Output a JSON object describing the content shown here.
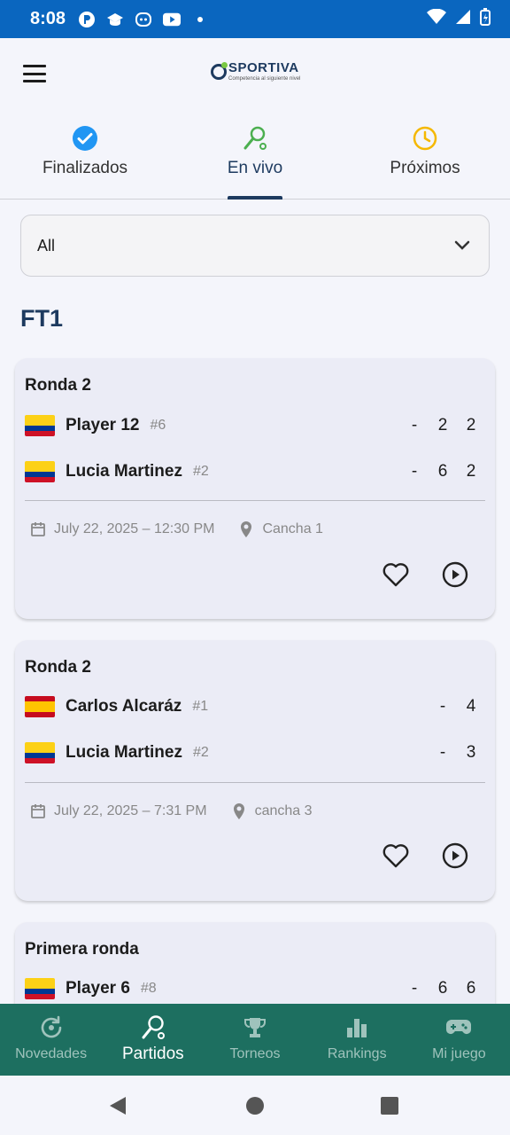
{
  "status_bar": {
    "time": "8:08"
  },
  "header": {
    "logo_name": "SPORTIVA",
    "logo_tagline": "Competencia al siguiente nivel"
  },
  "tabs": [
    {
      "label": "Finalizados",
      "icon": "check-circle-icon",
      "color": "#2196f3",
      "active": false
    },
    {
      "label": "En vivo",
      "icon": "tennis-racket-icon",
      "color": "#4caf50",
      "active": true
    },
    {
      "label": "Próximos",
      "icon": "clock-icon",
      "color": "#f5b800",
      "active": false
    }
  ],
  "filter": {
    "value": "All"
  },
  "section": {
    "title": "FT1"
  },
  "matches": [
    {
      "round": "Ronda 2",
      "players": [
        {
          "flag": "CO",
          "name": "Player 12",
          "seed": "#6",
          "scores": [
            "-",
            "2",
            "2"
          ]
        },
        {
          "flag": "CO",
          "name": "Lucia Martinez",
          "seed": "#2",
          "scores": [
            "-",
            "6",
            "2"
          ]
        }
      ],
      "datetime": "July 22, 2025 – 12:30 PM",
      "court": "Cancha 1"
    },
    {
      "round": "Ronda 2",
      "players": [
        {
          "flag": "ES",
          "name": "Carlos Alcaráz",
          "seed": "#1",
          "scores": [
            "-",
            "4"
          ]
        },
        {
          "flag": "CO",
          "name": "Lucia Martinez",
          "seed": "#2",
          "scores": [
            "-",
            "3"
          ]
        }
      ],
      "datetime": "July 22, 2025 – 7:31 PM",
      "court": "cancha 3"
    },
    {
      "round": "Primera ronda",
      "players": [
        {
          "flag": "CO",
          "name": "Player 6",
          "seed": "#8",
          "scores": [
            "-",
            "6",
            "6"
          ]
        }
      ]
    }
  ],
  "bottom_nav": [
    {
      "label": "Novedades",
      "icon": "refresh-icon",
      "active": false
    },
    {
      "label": "Partidos",
      "icon": "tennis-racket-icon",
      "active": true
    },
    {
      "label": "Torneos",
      "icon": "trophy-icon",
      "active": false
    },
    {
      "label": "Rankings",
      "icon": "bar-chart-icon",
      "active": false
    },
    {
      "label": "Mi juego",
      "icon": "gamepad-icon",
      "active": false
    }
  ],
  "colors": {
    "status_bar": "#0a66bf",
    "primary": "#1d3a5f",
    "bottom_nav": "#1d6f60",
    "card": "#ebecf6"
  }
}
